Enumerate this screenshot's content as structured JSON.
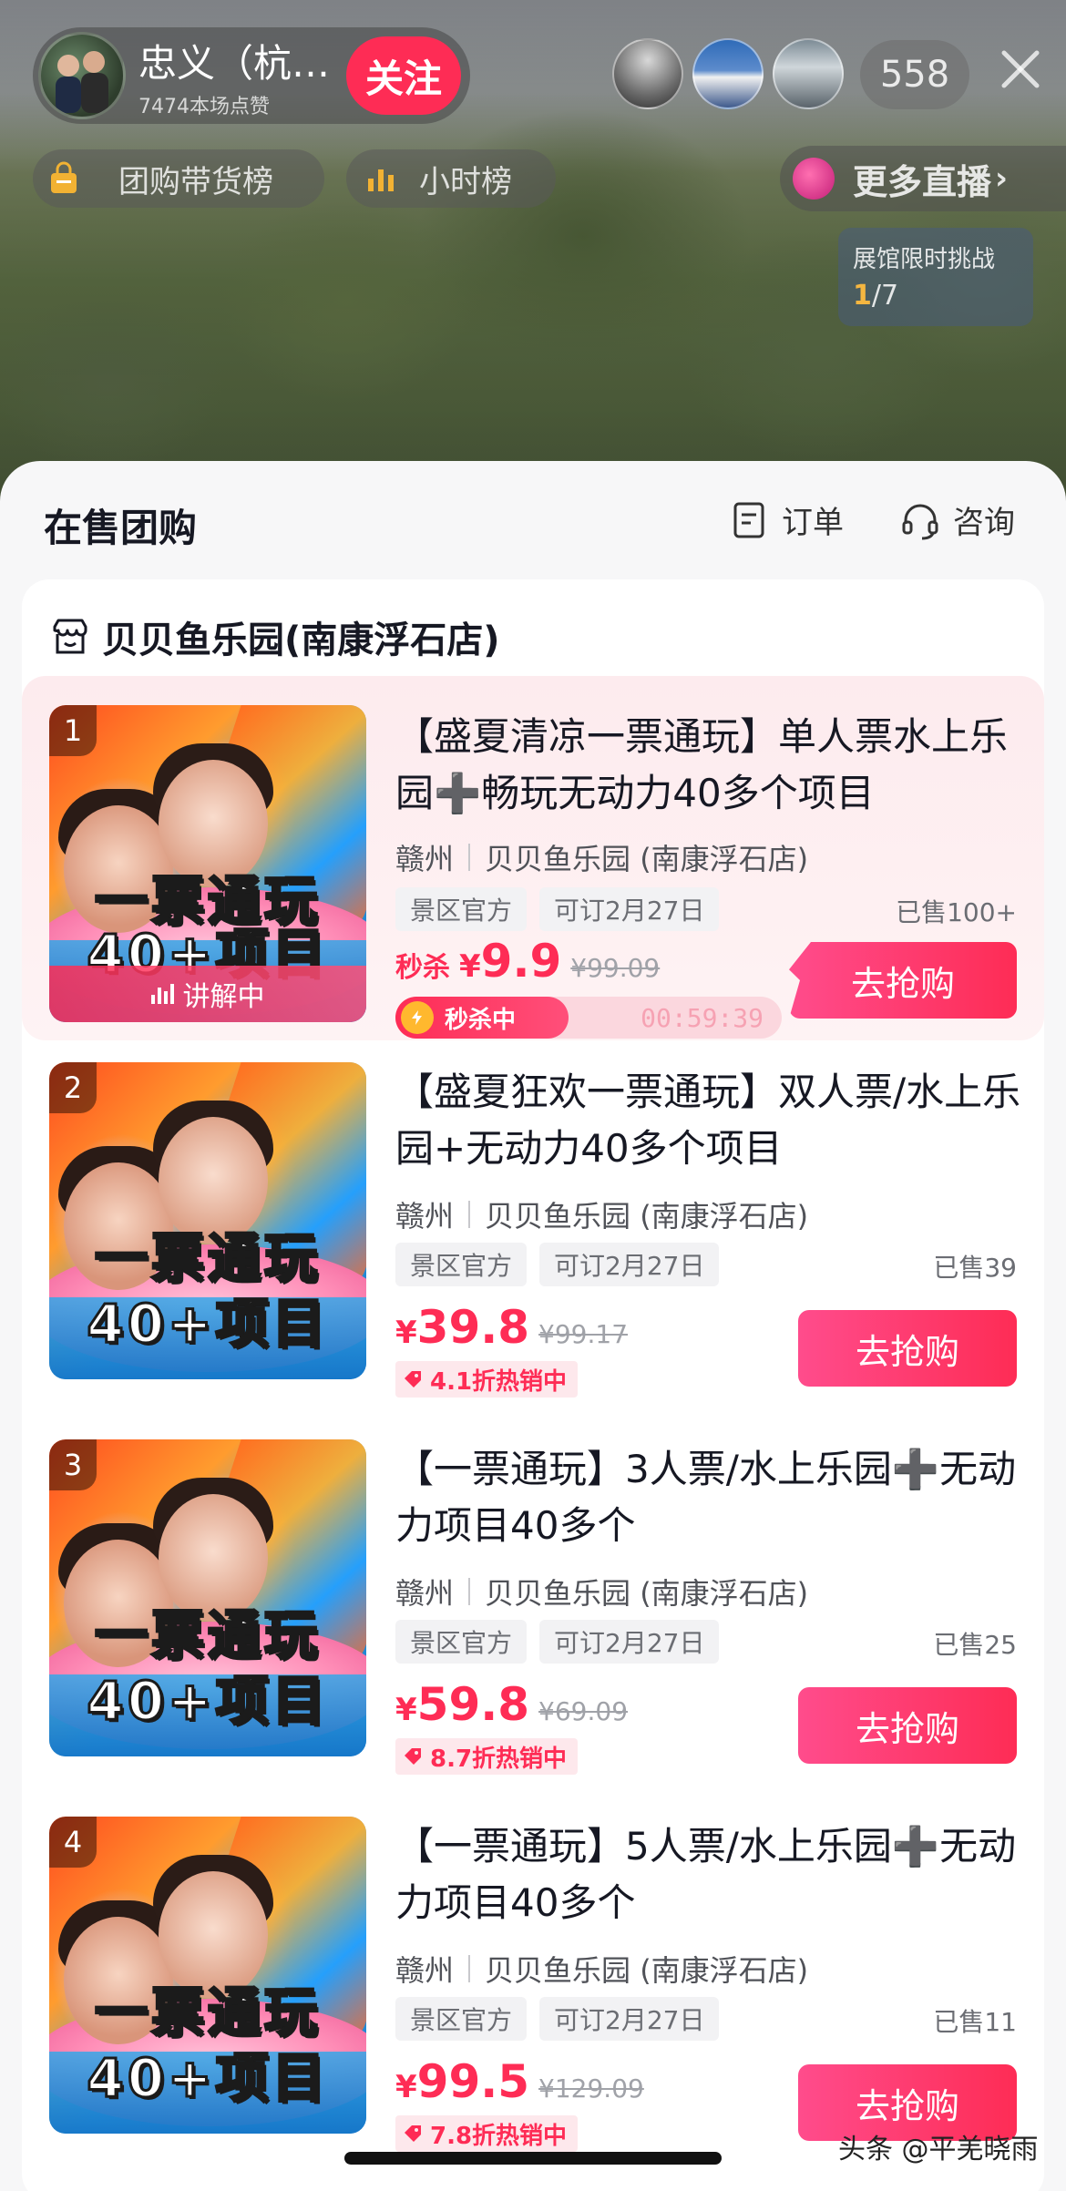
{
  "live": {
    "host_name": "忠义（杭…",
    "host_likes": "7474本场点赞",
    "follow_label": "关注",
    "viewer_count": "558",
    "chip_group_buy": "团购带货榜",
    "chip_hourly": "小时榜",
    "more_live": "更多直播",
    "challenge_title": "展馆限时挑战",
    "challenge_current": "1",
    "challenge_total": "/7"
  },
  "sheet": {
    "title": "在售团购",
    "orders_label": "订单",
    "consult_label": "咨询",
    "store_name": "贝贝鱼乐园(南康浮石店)"
  },
  "products": [
    {
      "rank": "1",
      "title": "【盛夏清凉一票通玩】单人票水上乐园➕畅玩无动力40多个项目",
      "city": "赣州",
      "store": "贝贝鱼乐园 (南康浮石店)",
      "tags": [
        "景区官方",
        "可订2月27日"
      ],
      "sold": "已售100+",
      "flash_label": "秒杀",
      "currency": "¥",
      "price": "9.9",
      "original_price": "¥99.09",
      "flash_status": "秒杀中",
      "countdown": "00:59:39",
      "explaining": "讲解中",
      "overlay_line1": "一票通玩",
      "overlay_line2": "40+项目",
      "buy_label": "去抢购"
    },
    {
      "rank": "2",
      "title": "【盛夏狂欢一票通玩】双人票/水上乐园+无动力40多个项目",
      "city": "赣州",
      "store": "贝贝鱼乐园 (南康浮石店)",
      "tags": [
        "景区官方",
        "可订2月27日"
      ],
      "sold": "已售39",
      "currency": "¥",
      "price": "39.8",
      "original_price": "¥99.17",
      "discount": "4.1折热销中",
      "overlay_line1": "一票通玩",
      "overlay_line2": "40+项目",
      "buy_label": "去抢购"
    },
    {
      "rank": "3",
      "title": "【一票通玩】3人票/水上乐园➕无动力项目40多个",
      "city": "赣州",
      "store": "贝贝鱼乐园 (南康浮石店)",
      "tags": [
        "景区官方",
        "可订2月27日"
      ],
      "sold": "已售25",
      "currency": "¥",
      "price": "59.8",
      "original_price": "¥69.09",
      "discount": "8.7折热销中",
      "overlay_line1": "一票通玩",
      "overlay_line2": "40+项目",
      "buy_label": "去抢购"
    },
    {
      "rank": "4",
      "title": "【一票通玩】5人票/水上乐园➕无动力项目40多个",
      "city": "赣州",
      "store": "贝贝鱼乐园 (南康浮石店)",
      "tags": [
        "景区官方",
        "可订2月27日"
      ],
      "sold": "已售11",
      "currency": "¥",
      "price": "99.5",
      "original_price": "¥129.09",
      "discount": "7.8折热销中",
      "overlay_line1": "一票通玩",
      "overlay_line2": "40+项目",
      "buy_label": "去抢购"
    }
  ],
  "watermark": "头条 @平羌晓雨",
  "colors": {
    "accent": "#fe2c55",
    "challenge_highlight": "#f5b640"
  }
}
